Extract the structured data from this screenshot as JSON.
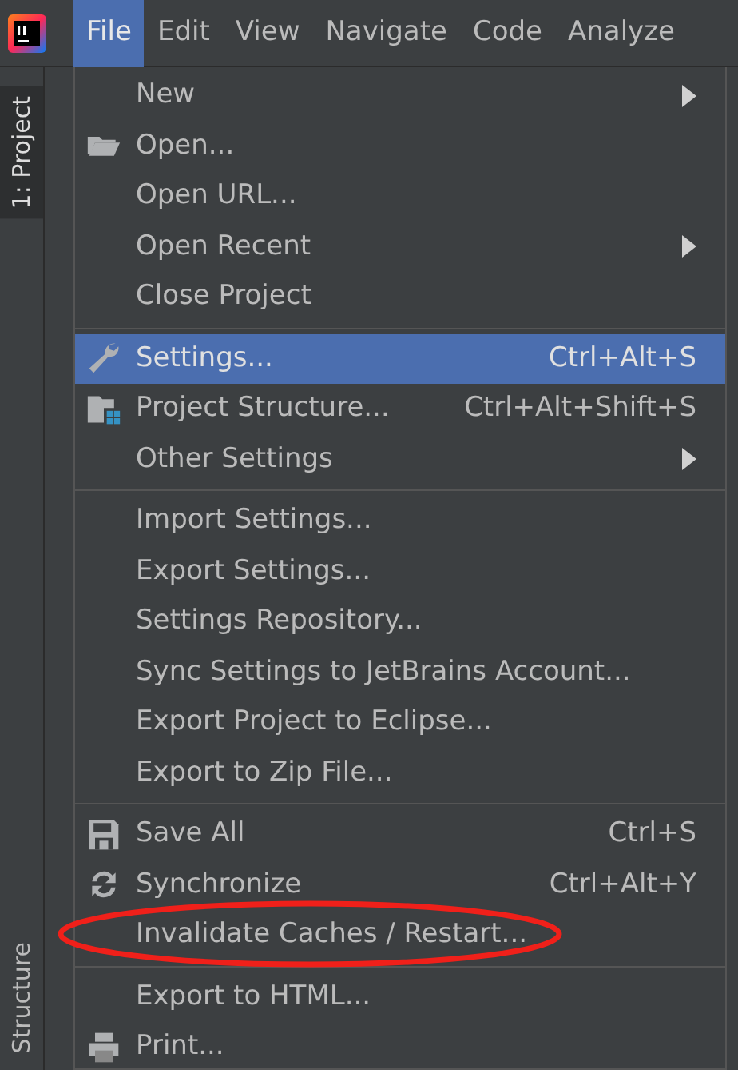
{
  "menubar": [
    {
      "label": "File",
      "selected": true
    },
    {
      "label": "Edit",
      "selected": false
    },
    {
      "label": "View",
      "selected": false
    },
    {
      "label": "Navigate",
      "selected": false
    },
    {
      "label": "Code",
      "selected": false
    },
    {
      "label": "Analyze",
      "selected": false
    }
  ],
  "side_tabs": [
    {
      "label": "1: Project"
    },
    {
      "label": "Structure"
    }
  ],
  "menu": {
    "items": [
      {
        "kind": "item",
        "label": "New",
        "submenu": true,
        "selected": false
      },
      {
        "kind": "item",
        "label": "Open...",
        "selected": false
      },
      {
        "kind": "item",
        "label": "Open URL...",
        "selected": false
      },
      {
        "kind": "item",
        "label": "Open Recent",
        "submenu": true,
        "selected": false
      },
      {
        "kind": "item",
        "label": "Close Project",
        "selected": false
      },
      {
        "kind": "separator"
      },
      {
        "kind": "item",
        "label": "Settings...",
        "shortcut": "Ctrl+Alt+S",
        "selected": true
      },
      {
        "kind": "item",
        "label": "Project Structure...",
        "shortcut": "Ctrl+Alt+Shift+S",
        "selected": false
      },
      {
        "kind": "item",
        "label": "Other Settings",
        "submenu": true,
        "selected": false
      },
      {
        "kind": "separator"
      },
      {
        "kind": "item",
        "label": "Import Settings...",
        "selected": false
      },
      {
        "kind": "item",
        "label": "Export Settings...",
        "selected": false
      },
      {
        "kind": "item",
        "label": "Settings Repository...",
        "selected": false
      },
      {
        "kind": "item",
        "label": "Sync Settings to JetBrains Account...",
        "selected": false
      },
      {
        "kind": "item",
        "label": "Export Project to Eclipse...",
        "selected": false
      },
      {
        "kind": "item",
        "label": "Export to Zip File...",
        "selected": false
      },
      {
        "kind": "separator"
      },
      {
        "kind": "item",
        "label": "Save All",
        "shortcut": "Ctrl+S",
        "selected": false
      },
      {
        "kind": "item",
        "label": "Synchronize",
        "shortcut": "Ctrl+Alt+Y",
        "selected": false
      },
      {
        "kind": "item",
        "label": "Invalidate Caches / Restart...",
        "selected": false,
        "circled": true
      },
      {
        "kind": "separator"
      },
      {
        "kind": "item",
        "label": "Export to HTML...",
        "selected": false
      },
      {
        "kind": "item",
        "label": "Print...",
        "selected": false
      }
    ]
  }
}
